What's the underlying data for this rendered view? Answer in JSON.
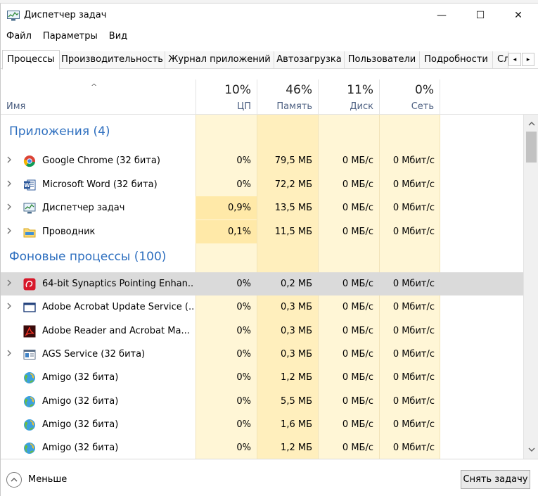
{
  "window": {
    "title": "Диспетчер задач",
    "controls": {
      "minimize": "—",
      "maximize": "☐",
      "close": "✕"
    }
  },
  "menu": [
    "Файл",
    "Параметры",
    "Вид"
  ],
  "tabs": [
    {
      "label": "Процессы",
      "active": true
    },
    {
      "label": "Производительность"
    },
    {
      "label": "Журнал приложений"
    },
    {
      "label": "Автозагрузка"
    },
    {
      "label": "Пользователи"
    },
    {
      "label": "Подробности"
    },
    {
      "label": "Службы"
    }
  ],
  "tab_scroll": {
    "left": "◂",
    "right": "▸"
  },
  "columns": {
    "name": "Имя",
    "sort_glyph": "^",
    "cpu": {
      "pct": "10%",
      "label": "ЦП"
    },
    "memory": {
      "pct": "46%",
      "label": "Память"
    },
    "disk": {
      "pct": "11%",
      "label": "Диск"
    },
    "network": {
      "pct": "0%",
      "label": "Сеть"
    }
  },
  "groups": {
    "apps": "Приложения (4)",
    "background": "Фоновые процессы (100)"
  },
  "apps": [
    {
      "name": "Google Chrome (32 бита)",
      "icon": "chrome-icon",
      "cpu": "0%",
      "mem": "79,5 МБ",
      "disk": "0 МБ/с",
      "net": "0 Мбит/с",
      "expand": true
    },
    {
      "name": "Microsoft Word (32 бита)",
      "icon": "word-icon",
      "cpu": "0%",
      "mem": "72,2 МБ",
      "disk": "0 МБ/с",
      "net": "0 Мбит/с",
      "expand": true
    },
    {
      "name": "Диспетчер задач",
      "icon": "task-manager-icon",
      "cpu": "0,9%",
      "mem": "13,5 МБ",
      "disk": "0 МБ/с",
      "net": "0 Мбит/с",
      "expand": true
    },
    {
      "name": "Проводник",
      "icon": "explorer-folder-icon",
      "cpu": "0,1%",
      "mem": "11,5 МБ",
      "disk": "0 МБ/с",
      "net": "0 Мбит/с",
      "expand": true
    }
  ],
  "background": [
    {
      "name": "64-bit Synaptics Pointing Enhan...",
      "icon": "synaptics-icon",
      "cpu": "0%",
      "mem": "0,2 МБ",
      "disk": "0 МБ/с",
      "net": "0 Мбит/с",
      "expand": true,
      "selected": true
    },
    {
      "name": "Adobe Acrobat Update Service (...",
      "icon": "service-window-icon",
      "cpu": "0%",
      "mem": "0,3 МБ",
      "disk": "0 МБ/с",
      "net": "0 Мбит/с",
      "expand": true
    },
    {
      "name": "Adobe Reader and Acrobat Ma...",
      "icon": "acrobat-icon",
      "cpu": "0%",
      "mem": "0,3 МБ",
      "disk": "0 МБ/с",
      "net": "0 Мбит/с",
      "expand": false
    },
    {
      "name": "AGS Service (32 бита)",
      "icon": "service-app-icon",
      "cpu": "0%",
      "mem": "0,3 МБ",
      "disk": "0 МБ/с",
      "net": "0 Мбит/с",
      "expand": true
    },
    {
      "name": "Amigo (32 бита)",
      "icon": "amigo-globe-icon",
      "cpu": "0%",
      "mem": "1,2 МБ",
      "disk": "0 МБ/с",
      "net": "0 Мбит/с",
      "expand": false
    },
    {
      "name": "Amigo (32 бита)",
      "icon": "amigo-globe-icon",
      "cpu": "0%",
      "mem": "5,5 МБ",
      "disk": "0 МБ/с",
      "net": "0 Мбит/с",
      "expand": false
    },
    {
      "name": "Amigo (32 бита)",
      "icon": "amigo-globe-icon",
      "cpu": "0%",
      "mem": "1,6 МБ",
      "disk": "0 МБ/с",
      "net": "0 Мбит/с",
      "expand": false
    },
    {
      "name": "Amigo (32 бита)",
      "icon": "amigo-globe-icon",
      "cpu": "0%",
      "mem": "1,2 МБ",
      "disk": "0 МБ/с",
      "net": "0 Мбит/с",
      "expand": false
    }
  ],
  "footer": {
    "less_label": "Меньше",
    "end_task": "Снять задачу"
  },
  "colors": {
    "group_title": "#2e6fbf",
    "header_label": "#4d6082",
    "heat_light": "#fff8dc",
    "heat_mid": "#fff1c1",
    "heat_strong": "#ffe9a8",
    "selected_row": "#dadada"
  }
}
